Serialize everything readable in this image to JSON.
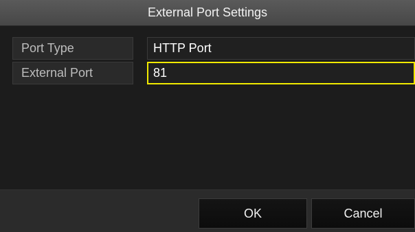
{
  "dialog": {
    "title": "External Port Settings"
  },
  "form": {
    "port_type_label": "Port Type",
    "port_type_value": "HTTP Port",
    "external_port_label": "External Port",
    "external_port_value": "81"
  },
  "buttons": {
    "ok_label": "OK",
    "cancel_label": "Cancel"
  },
  "colors": {
    "focus_border": "#f2ea00",
    "title_bg": "#4f4f4f",
    "panel_bg": "#1c1c1c"
  }
}
